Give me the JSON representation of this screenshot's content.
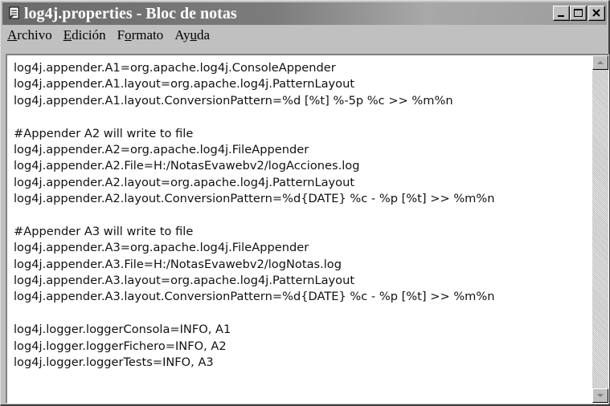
{
  "window": {
    "title": "log4j.properties - Bloc de notas",
    "icon": "notepad-icon",
    "controls": [
      "minimize-icon",
      "maximize-icon",
      "close-icon"
    ]
  },
  "menu": [
    {
      "accel": "A",
      "rest": "rchivo"
    },
    {
      "accel": "E",
      "rest": "dición"
    },
    {
      "pre": "F",
      "accel": "o",
      "rest": "rmato"
    },
    {
      "pre": "Ay",
      "accel": "u",
      "rest": "da"
    }
  ],
  "editor": {
    "lines": [
      "log4j.appender.A1=org.apache.log4j.ConsoleAppender",
      "log4j.appender.A1.layout=org.apache.log4j.PatternLayout",
      "log4j.appender.A1.layout.ConversionPattern=%d [%t] %-5p %c >> %m%n",
      "",
      "#Appender A2 will write to file",
      "log4j.appender.A2=org.apache.log4j.FileAppender",
      "log4j.appender.A2.File=H:/NotasEvawebv2/logAcciones.log",
      "log4j.appender.A2.layout=org.apache.log4j.PatternLayout",
      "log4j.appender.A2.layout.ConversionPattern=%d{DATE} %c - %p [%t] >> %m%n",
      "",
      "#Appender A3 will write to file",
      "log4j.appender.A3=org.apache.log4j.FileAppender",
      "log4j.appender.A3.File=H:/NotasEvawebv2/logNotas.log",
      "log4j.appender.A3.layout=org.apache.log4j.PatternLayout",
      "log4j.appender.A3.layout.ConversionPattern=%d{DATE} %c - %p [%t] >> %m%n",
      "",
      "log4j.logger.loggerConsola=INFO, A1",
      "log4j.logger.loggerFichero=INFO, A2",
      "log4j.logger.loggerTests=INFO, A3"
    ]
  },
  "scrollbar": {
    "up_icon": "scroll-up-arrow-icon",
    "down_icon": "scroll-down-arrow-icon"
  }
}
